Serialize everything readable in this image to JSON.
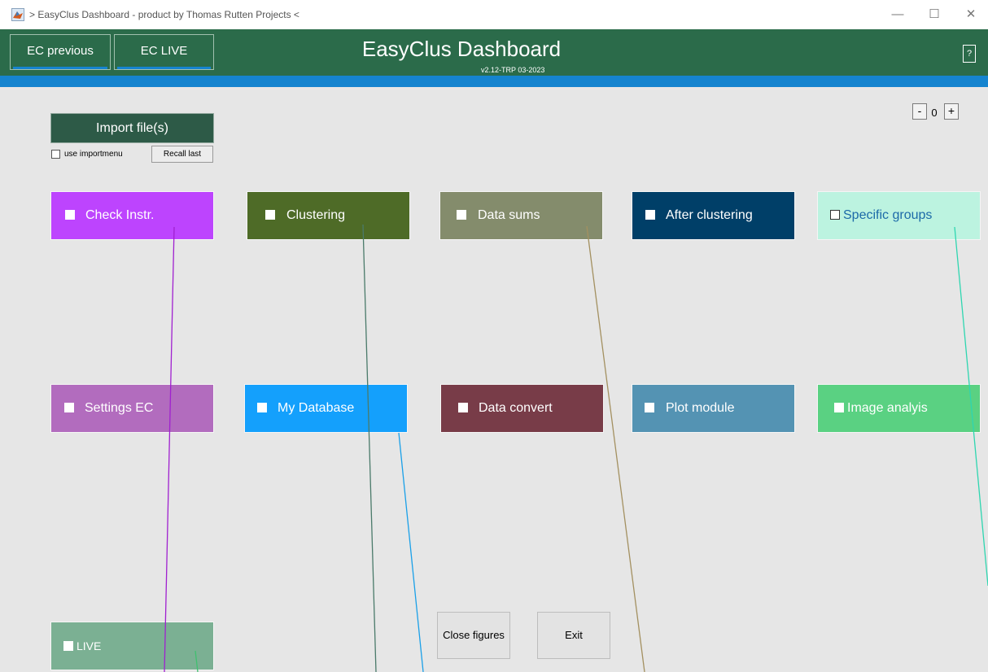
{
  "window": {
    "title": "> EasyClus Dashboard - product by Thomas Rutten Projects <",
    "controls": [
      "—",
      "☐",
      "✕"
    ]
  },
  "header": {
    "btn_previous": "EC previous",
    "btn_live": "EC LIVE",
    "title": "EasyClus Dashboard",
    "version": "v2.12-TRP 03-2023",
    "help": "?"
  },
  "zoom": {
    "minus": "-",
    "value": "0",
    "plus": "+"
  },
  "import": {
    "button": "Import file(s)",
    "use_importmenu": "use importmenu",
    "recall_last": "Recall last"
  },
  "modules": {
    "check_instr": "Check Instr.",
    "clustering": "Clustering",
    "data_sums": "Data sums",
    "after_clustering": "After clustering",
    "specific_groups": "Specific groups",
    "settings_ec": "Settings EC",
    "my_database": "My Database",
    "data_convert": "Data convert",
    "plot_module": "Plot module",
    "image_analysis": "Image analyis",
    "live": "LIVE"
  },
  "actions": {
    "close_figures": "Close figures",
    "exit": "Exit"
  },
  "colors": {
    "header": "#2b6b4a",
    "accent_bar": "#1584cf",
    "check_instr": "#bd44fe",
    "clustering": "#4e6b27",
    "data_sums": "#848c6c",
    "after_clustering": "#003f68",
    "specific_groups": "#bcf3e0",
    "settings_ec": "#b26cbe",
    "my_database": "#14a0fc",
    "data_convert": "#783c48",
    "plot_module": "#5493b3",
    "image_analysis": "#5ad182",
    "live": "#7bb093"
  }
}
